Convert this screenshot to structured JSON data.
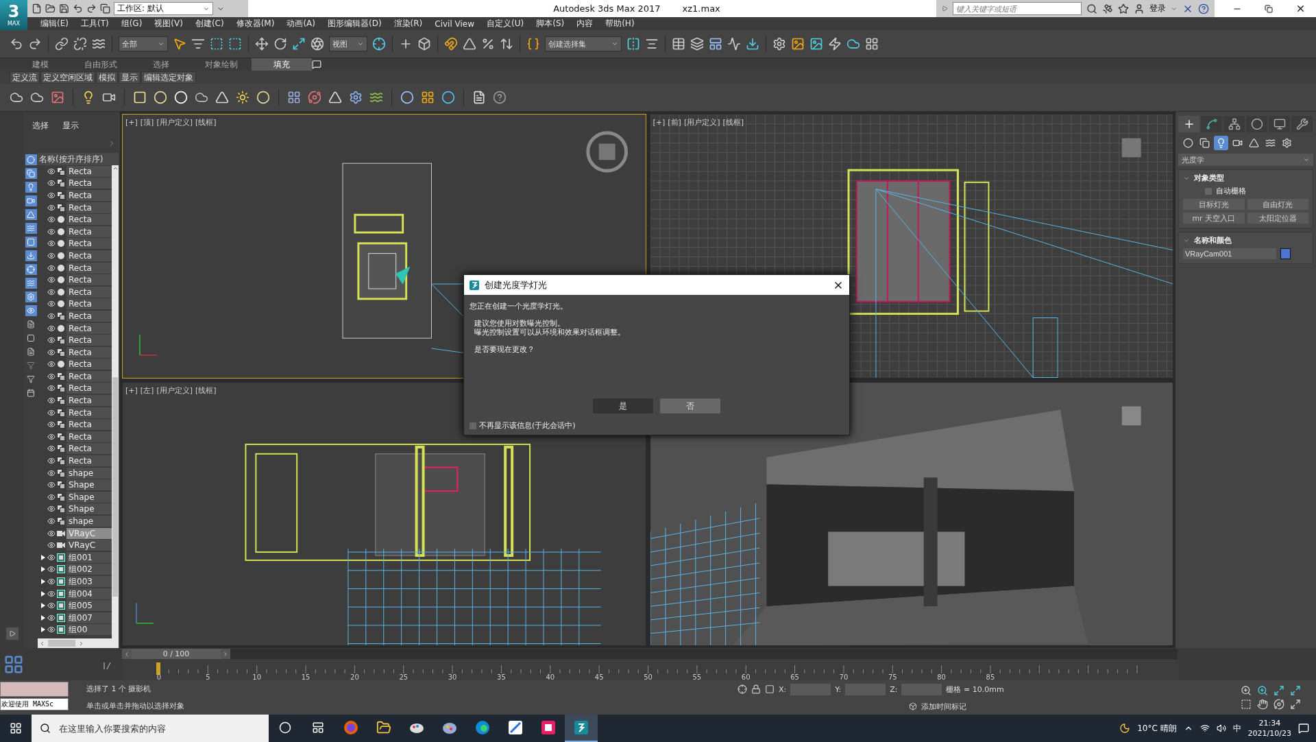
{
  "logo": {
    "digit": "3",
    "caption": "MAX"
  },
  "title_bar": {
    "workspace": "工作区: 默认",
    "app_title": "Autodesk 3ds Max 2017",
    "file_name": "xz1.max",
    "search": {
      "placeholder": "键入关键字或短语"
    },
    "sign_in": "登录"
  },
  "menu": [
    "编辑(E)",
    "工具(T)",
    "组(G)",
    "视图(V)",
    "创建(C)",
    "修改器(M)",
    "动画(A)",
    "图形编辑器(D)",
    "渲染(R)",
    "Civil View",
    "自定义(U)",
    "脚本(S)",
    "内容",
    "帮助(H)"
  ],
  "toolbar": {
    "selection_filter": "全部",
    "reference_coord": "视图",
    "named_selection": "创建选择集"
  },
  "ribbon": {
    "tabs": [
      {
        "label": "建模",
        "selected": false
      },
      {
        "label": "自由形式",
        "selected": false
      },
      {
        "label": "选择",
        "selected": false
      },
      {
        "label": "对象绘制",
        "selected": false
      },
      {
        "label": "填充",
        "selected": true
      }
    ],
    "panel_buttons": [
      "定义流",
      "定义空闲区域",
      "模拟",
      "显示",
      "编辑选定对象"
    ]
  },
  "scene_explorer": {
    "tabs": [
      "选择",
      "显示"
    ],
    "column_header": "名称(按升序排序)",
    "items": [
      {
        "name": "Recta",
        "kind": "shape",
        "selected": false
      },
      {
        "name": "Recta",
        "kind": "shape",
        "selected": false
      },
      {
        "name": "Recta",
        "kind": "shape",
        "selected": false
      },
      {
        "name": "Recta",
        "kind": "shape",
        "selected": false
      },
      {
        "name": "Recta",
        "kind": "geometry",
        "selected": false
      },
      {
        "name": "Recta",
        "kind": "geometry",
        "selected": false
      },
      {
        "name": "Recta",
        "kind": "geometry",
        "selected": false
      },
      {
        "name": "Recta",
        "kind": "geometry",
        "selected": false
      },
      {
        "name": "Recta",
        "kind": "geometry",
        "selected": false
      },
      {
        "name": "Recta",
        "kind": "geometry",
        "selected": false
      },
      {
        "name": "Recta",
        "kind": "geometry",
        "selected": false
      },
      {
        "name": "Recta",
        "kind": "geometry",
        "selected": false
      },
      {
        "name": "Recta",
        "kind": "shape",
        "selected": false
      },
      {
        "name": "Recta",
        "kind": "geometry",
        "selected": false
      },
      {
        "name": "Recta",
        "kind": "shape",
        "selected": false
      },
      {
        "name": "Recta",
        "kind": "shape",
        "selected": false
      },
      {
        "name": "Recta",
        "kind": "geometry",
        "selected": false
      },
      {
        "name": "Recta",
        "kind": "shape",
        "selected": false
      },
      {
        "name": "Recta",
        "kind": "shape",
        "selected": false
      },
      {
        "name": "Recta",
        "kind": "shape",
        "selected": false
      },
      {
        "name": "Recta",
        "kind": "shape",
        "selected": false
      },
      {
        "name": "Recta",
        "kind": "shape",
        "selected": false
      },
      {
        "name": "Recta",
        "kind": "shape",
        "selected": false
      },
      {
        "name": "Recta",
        "kind": "shape",
        "selected": false
      },
      {
        "name": "Recta",
        "kind": "shape",
        "selected": false
      },
      {
        "name": "shape",
        "kind": "shape",
        "selected": false
      },
      {
        "name": "Shape",
        "kind": "shape",
        "selected": false
      },
      {
        "name": "Shape",
        "kind": "shape",
        "selected": false
      },
      {
        "name": "Shape",
        "kind": "shape",
        "selected": false
      },
      {
        "name": "shape",
        "kind": "shape",
        "selected": false
      },
      {
        "name": "VRayC",
        "kind": "camera",
        "selected": true
      },
      {
        "name": "VRayC",
        "kind": "camera",
        "selected": false
      },
      {
        "name": "组001",
        "kind": "group",
        "selected": false,
        "expanded": false
      },
      {
        "name": "组002",
        "kind": "group",
        "selected": false,
        "expanded": false
      },
      {
        "name": "组003",
        "kind": "group",
        "selected": false,
        "expanded": false
      },
      {
        "name": "组004",
        "kind": "group",
        "selected": false,
        "expanded": false
      },
      {
        "name": "组005",
        "kind": "group",
        "selected": false,
        "expanded": false
      },
      {
        "name": "组007",
        "kind": "group",
        "selected": false,
        "expanded": false
      },
      {
        "name": "组00",
        "kind": "group",
        "selected": false,
        "expanded": false
      }
    ]
  },
  "viewports": [
    {
      "kind": "top",
      "active": true,
      "menus": [
        "[+]",
        "[顶]",
        "[用户定义]",
        "[线框]"
      ]
    },
    {
      "kind": "front",
      "active": false,
      "menus": [
        "[+]",
        "[前]",
        "[用户定义]",
        "[线框]"
      ]
    },
    {
      "kind": "left",
      "active": false,
      "menus": [
        "[+]",
        "[左]",
        "[用户定义]",
        "[线框]"
      ]
    },
    {
      "kind": "camera",
      "active": false
    }
  ],
  "dialog": {
    "title": "创建光度学灯光",
    "message": "您正在创建一个光度学灯光。",
    "details": [
      "建议您使用对数曝光控制。",
      "曝光控制设置可以从环境和效果对话框调整。"
    ],
    "question": "是否要现在更改？",
    "buttons": [
      {
        "label": "是",
        "selected": true
      },
      {
        "label": "否",
        "selected": false
      }
    ],
    "checkbox": {
      "label": "不再显示该信息(于此会话中)",
      "checked": false
    }
  },
  "command_panel": {
    "tabs": [
      {
        "kind": "create",
        "selected": true
      },
      {
        "kind": "modify",
        "selected": false
      },
      {
        "kind": "hierarchy",
        "selected": false
      },
      {
        "kind": "motion",
        "selected": false
      },
      {
        "kind": "display",
        "selected": false
      },
      {
        "kind": "utilities",
        "selected": false
      }
    ],
    "categories": [
      {
        "kind": "geometry",
        "selected": false
      },
      {
        "kind": "shapes",
        "selected": false
      },
      {
        "kind": "lights",
        "selected": true
      },
      {
        "kind": "cameras",
        "selected": false
      },
      {
        "kind": "helpers",
        "selected": false
      },
      {
        "kind": "spacewarps",
        "selected": false
      },
      {
        "kind": "systems",
        "selected": false
      }
    ],
    "category_dropdown": "光度学",
    "object_type": {
      "title": "对象类型",
      "auto_grid": {
        "label": "自动栅格",
        "checked": false
      },
      "buttons": [
        "目标灯光",
        "自由灯光",
        "mr 天空入口",
        "太阳定位器"
      ]
    },
    "name_and_color": {
      "title": "名称和颜色",
      "name": "VRayCam001",
      "color": "#4f74d6"
    }
  },
  "timeline": {
    "frame": "0 / 100",
    "ticks": [
      "0",
      "5",
      "10",
      "15",
      "20",
      "25",
      "30",
      "35",
      "40",
      "45",
      "50",
      "55",
      "60",
      "65",
      "70",
      "75",
      "80",
      "85"
    ]
  },
  "status_bar": {
    "listener": "欢迎使用 MAXSc",
    "selection_info": "选择了 1 个 摄影机",
    "prompt": "单击或单击并拖动以选择对象",
    "coords": [
      "X:",
      "Y:",
      "Z:"
    ],
    "grid": "栅格 = 10.0mm",
    "time_tag": "添加时间标记"
  },
  "taskbar": {
    "search_placeholder": "在这里输入你要搜索的内容",
    "apps": [
      {
        "kind": "cortana",
        "active": false
      },
      {
        "kind": "taskview",
        "active": false
      },
      {
        "kind": "firefox",
        "active": false
      },
      {
        "kind": "explorer",
        "active": false
      },
      {
        "kind": "palette",
        "active": false
      },
      {
        "kind": "paint",
        "active": false
      },
      {
        "kind": "edge",
        "active": false
      },
      {
        "kind": "sketch",
        "active": false
      },
      {
        "kind": "photos",
        "active": false
      },
      {
        "kind": "max",
        "active": true
      }
    ],
    "weather": "10°C 晴朗",
    "ime": "中",
    "time": "21:34",
    "date": "2021/10/23"
  }
}
